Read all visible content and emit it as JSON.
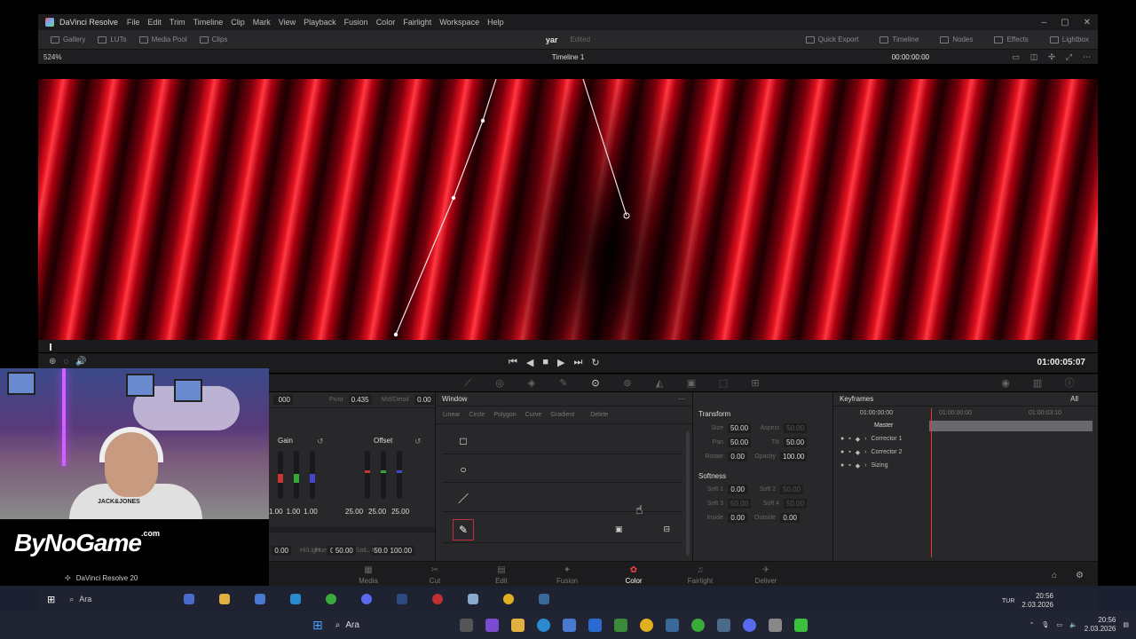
{
  "app": {
    "name": "DaVinci Resolve",
    "menu": [
      "File",
      "Edit",
      "Trim",
      "Timeline",
      "Clip",
      "Mark",
      "View",
      "Playback",
      "Fusion",
      "Color",
      "Fairlight",
      "Workspace",
      "Help"
    ]
  },
  "toolbar": {
    "left": [
      "Gallery",
      "LUTs",
      "Media Pool",
      "Clips"
    ],
    "project": "yar",
    "project_state": "Edited",
    "right": [
      "Quick Export",
      "Timeline",
      "Nodes",
      "Effects",
      "Lightbox"
    ]
  },
  "viewer": {
    "zoom": "524%",
    "timeline": "Timeline 1",
    "timecode": "00:00:00:00",
    "playhead_fraction": 0.011
  },
  "transport": {
    "timecode": "01:00:05:07"
  },
  "primaries": {
    "num_left": "000",
    "pivot_label": "Pivot",
    "pivot": "0.435",
    "middetail_label": "Mid/Detail",
    "middetail": "0.00",
    "gain_label": "Gain",
    "offset_label": "Offset",
    "gain_values": [
      "1.00",
      "1.00",
      "1.00"
    ],
    "offset_values": [
      "25.00",
      "25.00",
      "25.00"
    ],
    "bottom": {
      "a_val": "0.00",
      "hilight_label": "Hi/Light",
      "hilight": "0.00",
      "sat_label": "Sat",
      "sat": "50.00",
      "hue_label": "Hue",
      "hue": "50.00",
      "lmix_label": "L. Mix",
      "lmix": "100.00"
    }
  },
  "window_panel": {
    "title": "Window",
    "tools": [
      "Linear",
      "Circle",
      "Polygon",
      "Curve",
      "Gradient"
    ],
    "delete_label": "Delete"
  },
  "transform": {
    "title": "Transform",
    "size_label": "Size",
    "size": "50.00",
    "aspect_label": "Aspect",
    "aspect": "50.00",
    "pan_label": "Pan",
    "pan": "50.00",
    "tilt_label": "Tilt",
    "tilt": "50.00",
    "rotate_label": "Rotate",
    "rotate": "0.00",
    "opacity_label": "Opacity",
    "opacity": "100.00",
    "softness_title": "Softness",
    "soft1_label": "Soft 1",
    "soft1": "0.00",
    "soft2_label": "Soft 2",
    "soft2": "50.00",
    "soft3_label": "Soft 3",
    "soft3": "50.00",
    "soft4_label": "Soft 4",
    "soft4": "50.00",
    "inside_label": "Inside",
    "inside": "0.00",
    "outside_label": "Outside",
    "outside": "0.00"
  },
  "keyframes": {
    "title": "Keyframes",
    "filter": "All",
    "time": "01:00:00:00",
    "ruler_start": "01:00:00:00",
    "ruler_end": "01:00:03:10",
    "rows": [
      "Master",
      "Corrector 1",
      "Corrector 2",
      "Sizing"
    ]
  },
  "pages": [
    "Media",
    "Cut",
    "Edit",
    "Fusion",
    "Color",
    "Fairlight",
    "Deliver"
  ],
  "active_page": "Color",
  "status": {
    "version": "DaVinci Resolve 20"
  },
  "webcam": {
    "shirt_text": "JACK&JONES"
  },
  "watermark": {
    "text": "ByNoGame",
    "suffix": ".com"
  },
  "inner_taskbar": {
    "search": "Ara",
    "lang": "TUR",
    "time": "20:56",
    "date": "2.03.2026"
  },
  "taskbar": {
    "search": "Ara",
    "time": "20:56",
    "date": "2.03.2026"
  }
}
